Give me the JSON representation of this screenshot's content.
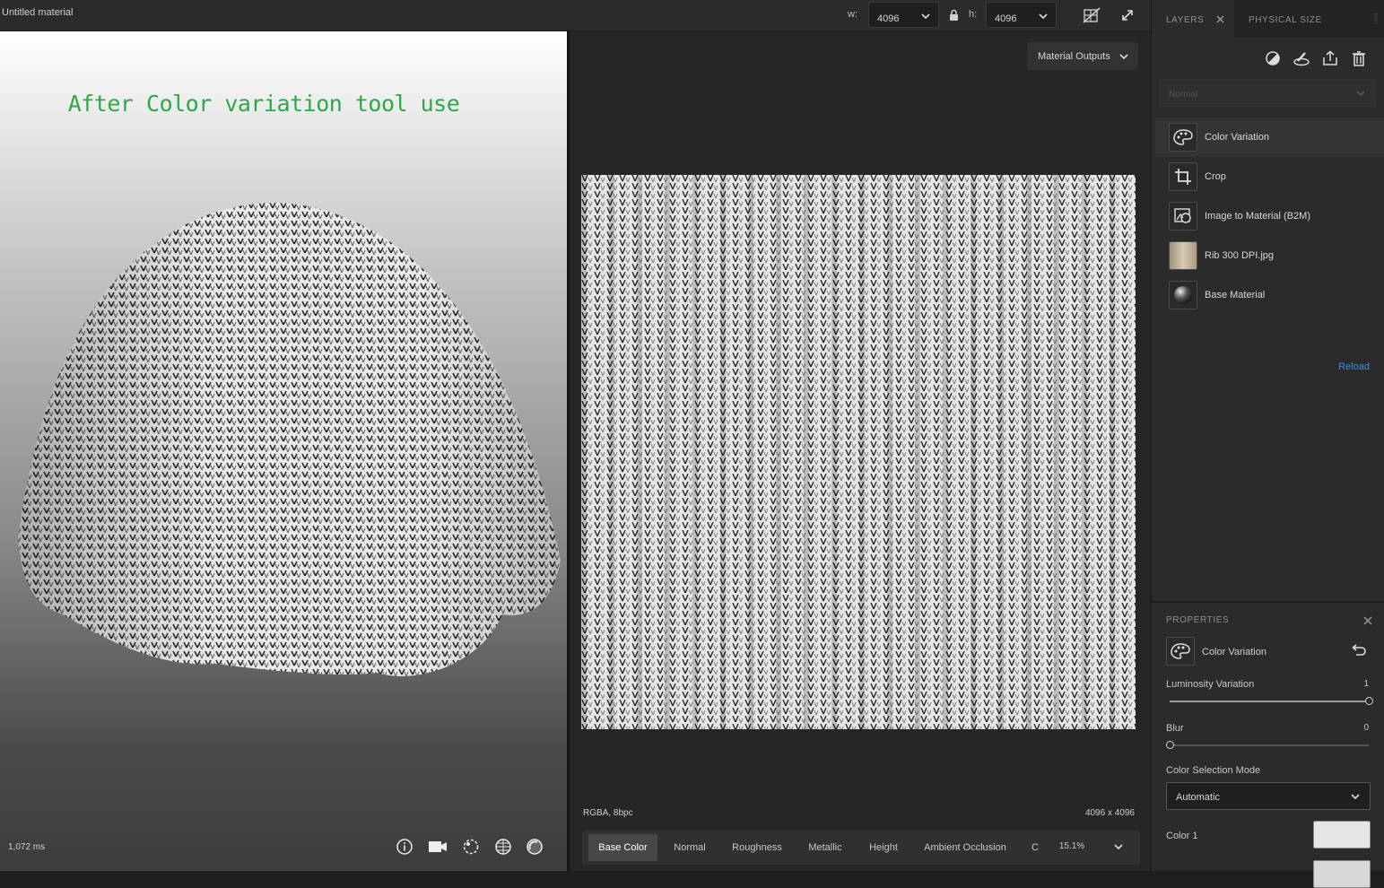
{
  "document": {
    "title": "Untitled material"
  },
  "size": {
    "w_label": "w:",
    "w_value": "4096",
    "h_label": "h:",
    "h_value": "4096"
  },
  "viewport3d": {
    "annotation": "After Color variation tool use",
    "render_time": "1,072 ms",
    "icons": [
      "info-icon",
      "camera-icon",
      "environment-icon",
      "grid-icon",
      "material-ball-icon"
    ]
  },
  "view2d": {
    "outputs_label": "Material Outputs",
    "format": "RGBA, 8bpc",
    "resolution": "4096 x 4096",
    "channels": [
      "Base Color",
      "Normal",
      "Roughness",
      "Metallic",
      "Height",
      "Ambient Occlusion",
      "C"
    ],
    "active_channel": "Base Color",
    "zoom": "15.1%"
  },
  "panel": {
    "tabs": {
      "layers": "LAYERS",
      "physical": "PHYSICAL SIZE"
    },
    "blend_mode": "Normal",
    "layers": [
      {
        "name": "Color Variation",
        "icon": "palette-icon",
        "selected": true
      },
      {
        "name": "Crop",
        "icon": "crop-icon",
        "selected": false
      },
      {
        "name": "Image to Material (B2M)",
        "icon": "image-to-material-icon",
        "selected": false
      },
      {
        "name": "Rib 300 DPI.jpg",
        "icon": "image-thumbnail",
        "selected": false
      },
      {
        "name": "Base Material",
        "icon": "sphere-icon",
        "selected": false
      }
    ],
    "reload": "Reload"
  },
  "properties": {
    "title": "PROPERTIES",
    "layer_name": "Color Variation",
    "luminosity": {
      "label": "Luminosity Variation",
      "value": "1",
      "fraction": 1.0
    },
    "blur": {
      "label": "Blur",
      "value": "0",
      "fraction": 0.0
    },
    "mode": {
      "label": "Color Selection Mode",
      "value": "Automatic"
    },
    "color1": {
      "label": "Color 1",
      "hex": "#e6e6e6"
    }
  }
}
